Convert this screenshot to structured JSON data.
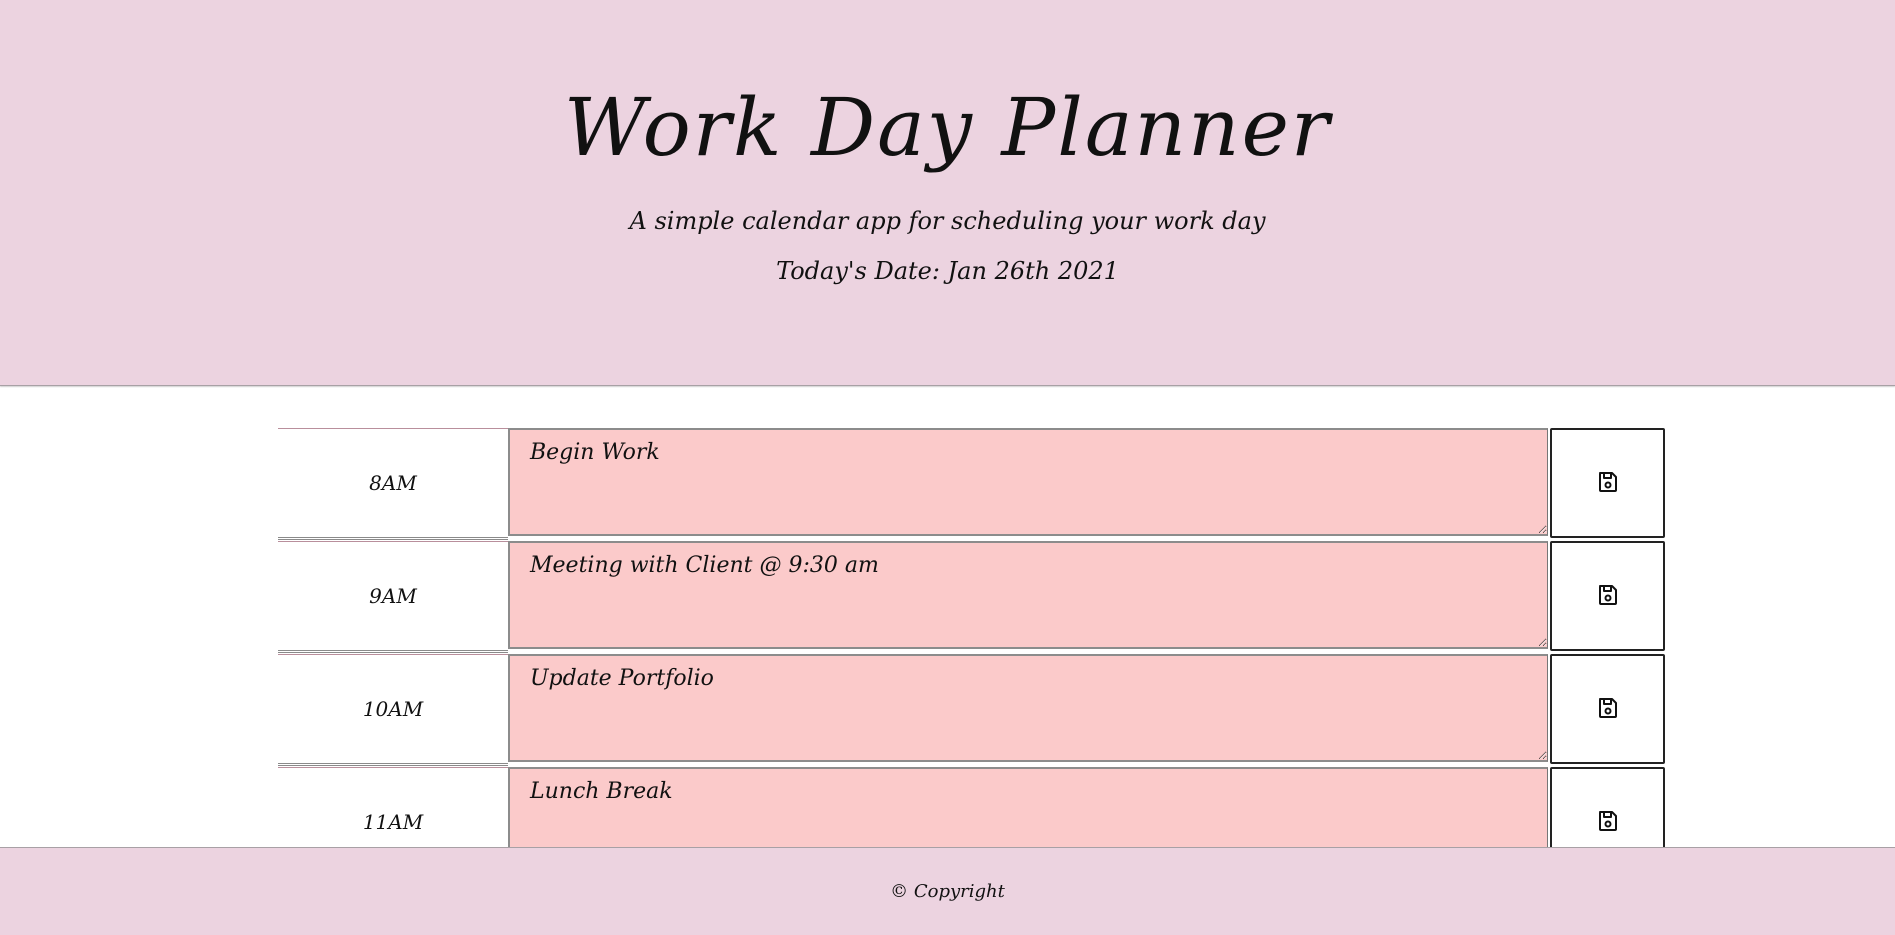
{
  "header": {
    "title": "Work Day Planner",
    "subtitle": "A simple calendar app for scheduling your work day",
    "date_text": "Today's Date: Jan 26th 2021"
  },
  "schedule": {
    "rows": [
      {
        "hour": "8AM",
        "task": "Begin Work",
        "save_icon": "floppy-disk-icon"
      },
      {
        "hour": "9AM",
        "task": "Meeting with Client @ 9:30 am",
        "save_icon": "floppy-disk-icon"
      },
      {
        "hour": "10AM",
        "task": "Update Portfolio",
        "save_icon": "floppy-disk-icon"
      },
      {
        "hour": "11AM",
        "task": "Lunch Break",
        "save_icon": "floppy-disk-icon"
      }
    ]
  },
  "footer": {
    "copyright": "© Copyright"
  },
  "colors": {
    "header_bg": "#ecd3e0",
    "task_bg": "#fbcaca",
    "page_bg": "#ffffff"
  }
}
